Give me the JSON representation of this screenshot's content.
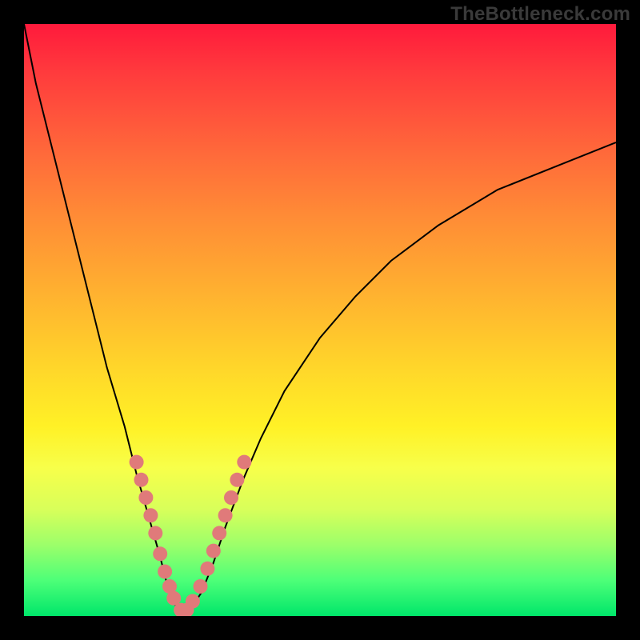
{
  "watermark": "TheBottleneck.com",
  "chart_data": {
    "type": "line",
    "title": "",
    "xlabel": "",
    "ylabel": "",
    "xlim": [
      0,
      100
    ],
    "ylim": [
      0,
      100
    ],
    "series": [
      {
        "name": "bottleneck-curve",
        "x": [
          0,
          2,
          5,
          8,
          11,
          14,
          17,
          19,
          21,
          23,
          24,
          25,
          26,
          27,
          28,
          30,
          32,
          34,
          37,
          40,
          44,
          50,
          56,
          62,
          70,
          80,
          90,
          100
        ],
        "y": [
          100,
          90,
          78,
          66,
          54,
          42,
          32,
          24,
          17,
          10,
          6,
          3,
          1,
          0,
          1,
          4,
          9,
          15,
          23,
          30,
          38,
          47,
          54,
          60,
          66,
          72,
          76,
          80
        ]
      }
    ],
    "markers": {
      "name": "highlight-dots",
      "color": "#e07a7a",
      "x": [
        19.0,
        19.8,
        20.6,
        21.4,
        22.2,
        23.0,
        23.8,
        24.6,
        25.3,
        26.5,
        27.5,
        28.5,
        29.8,
        31.0,
        32.0,
        33.0,
        34.0,
        35.0,
        36.0,
        37.2
      ],
      "y": [
        26.0,
        23.0,
        20.0,
        17.0,
        14.0,
        10.5,
        7.5,
        5.0,
        3.0,
        1.0,
        1.0,
        2.5,
        5.0,
        8.0,
        11.0,
        14.0,
        17.0,
        20.0,
        23.0,
        26.0
      ]
    },
    "gradient_bg": {
      "top": "#ff1a3c",
      "mid": "#ffd62a",
      "bottom": "#00e66a"
    }
  }
}
